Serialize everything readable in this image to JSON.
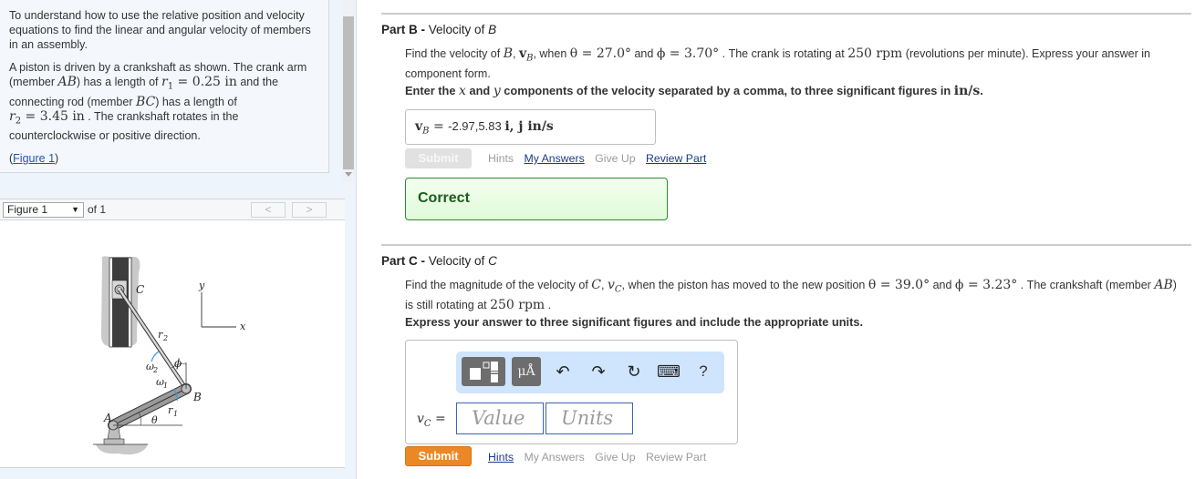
{
  "intro": {
    "para1": "To understand how to use the relative position and velocity equations to find the linear and angular velocity of members in an assembly.",
    "para2_a": "A piston is driven by a crankshaft as shown. The crank arm (member ",
    "member_ab": "AB",
    "para2_b": ") has a length of ",
    "r1_sym": "r",
    "r1_sub": "1",
    "r1_val": " = 0.25 in",
    "para2_c": " and the connecting rod (member ",
    "member_bc": "BC",
    "para2_d": ") has a length of ",
    "r2_sym": "r",
    "r2_sub": "2",
    "r2_val": " = 3.45 in",
    "para2_e": " . The crankshaft rotates in the counterclockwise or positive direction.",
    "figure_link_open": "(",
    "figure_link": "Figure 1",
    "figure_link_close": ")"
  },
  "figure_nav": {
    "selected": "Figure 1",
    "of_label": "of 1",
    "prev": "<",
    "next": ">"
  },
  "figure": {
    "labels": {
      "C": "C",
      "B": "B",
      "A": "A",
      "r2": "r",
      "r2_sub": "2",
      "r1": "r",
      "r1_sub": "1",
      "omega2": "ω",
      "omega2_sub": "2",
      "omega1": "ω",
      "omega1_sub": "1",
      "phi": "ϕ",
      "theta": "θ",
      "x": "x",
      "y": "y"
    },
    "colors": {
      "arrow": "#3d9ad6",
      "piston": "#3a3a3a",
      "housing": "#c8c8c8"
    }
  },
  "part_b": {
    "title_bold": "Part B -",
    "title_rest": " Velocity of ",
    "title_var": "B",
    "q1": "Find the velocity of ",
    "q_B": "B",
    "q_vB": "v",
    "q_vB_sub": "B",
    "q2": ", when ",
    "theta_eq": "θ = 27.0°",
    "q3": " and ",
    "phi_eq": "ϕ = 3.70°",
    "q4": " . The crank is rotating at ",
    "rpm": "250 rpm",
    "q5": " (revolutions per minute). Express your answer in component form.",
    "instr_a": "Enter the ",
    "instr_x": "x",
    "instr_b": " and ",
    "instr_y": "y",
    "instr_c": " components of the velocity separated by a comma, to three significant figures in ",
    "instr_units": "in/s",
    "instr_d": ".",
    "answer_label": "v",
    "answer_label_sub": "B",
    "answer_eq": " = ",
    "answer_value": "-2.97,5.83",
    "answer_units": "i, j in/s",
    "submit": "Submit",
    "links": {
      "hints": "Hints",
      "my_answers": "My Answers",
      "give_up": "Give Up",
      "review_part": "Review Part"
    },
    "feedback": "Correct"
  },
  "part_c": {
    "title_bold": "Part C -",
    "title_rest": " Velocity of ",
    "title_var": "C",
    "q1": "Find the magnitude of the velocity of ",
    "q_C": "C",
    "q_vC": "v",
    "q_vC_sub": "C",
    "q2": ", when the piston has moved to the new position ",
    "theta_eq": "θ = 39.0°",
    "q3": " and ",
    "phi_eq": "ϕ = 3.23°",
    "q4": " . The crankshaft (member ",
    "member": "AB",
    "q5": ") is still rotating at ",
    "rpm": "250 rpm",
    "q6": " .",
    "instr": "Express your answer to three significant figures and include the appropriate units.",
    "toolbar": {
      "templates_icon": "templates-icon",
      "units_label": "μÅ",
      "undo": "↶",
      "redo": "↷",
      "reset": "↻",
      "keyboard": "⌨",
      "help": "?"
    },
    "answer_label": "v",
    "answer_label_sub": "C",
    "answer_eq": " =",
    "value_placeholder": "Value",
    "units_placeholder": "Units",
    "submit": "Submit",
    "links": {
      "hints": "Hints",
      "my_answers": "My Answers",
      "give_up": "Give Up",
      "review_part": "Review Part"
    }
  }
}
